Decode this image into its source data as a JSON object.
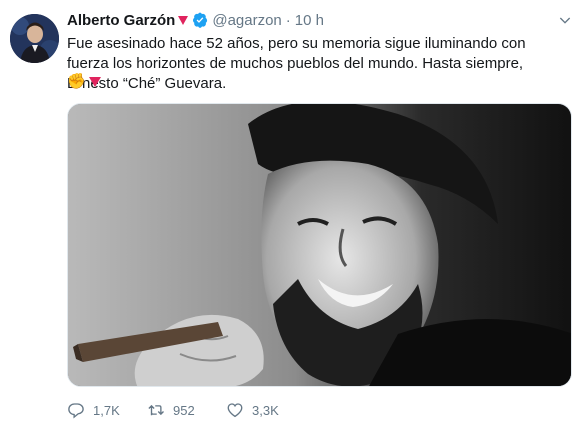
{
  "author": {
    "name": "Alberto Garzón",
    "handle": "@agarzon",
    "separator": "·",
    "time": "10 h"
  },
  "tweet": {
    "text": "Fue asesinado hace 52 años, pero su memoria sigue iluminando con fuerza los horizontes de muchos pueblos del mundo. Hasta siempre, Ernesto “Ché” Guevara.",
    "emoji": "✊"
  },
  "media": {
    "description_icon": "photo-che-guevara"
  },
  "actions": {
    "replies": "1,7K",
    "retweets": "952",
    "likes": "3,3K"
  },
  "colors": {
    "verified": "#1da1f2",
    "flag": "#e0245e",
    "secondary_text": "#657786"
  }
}
